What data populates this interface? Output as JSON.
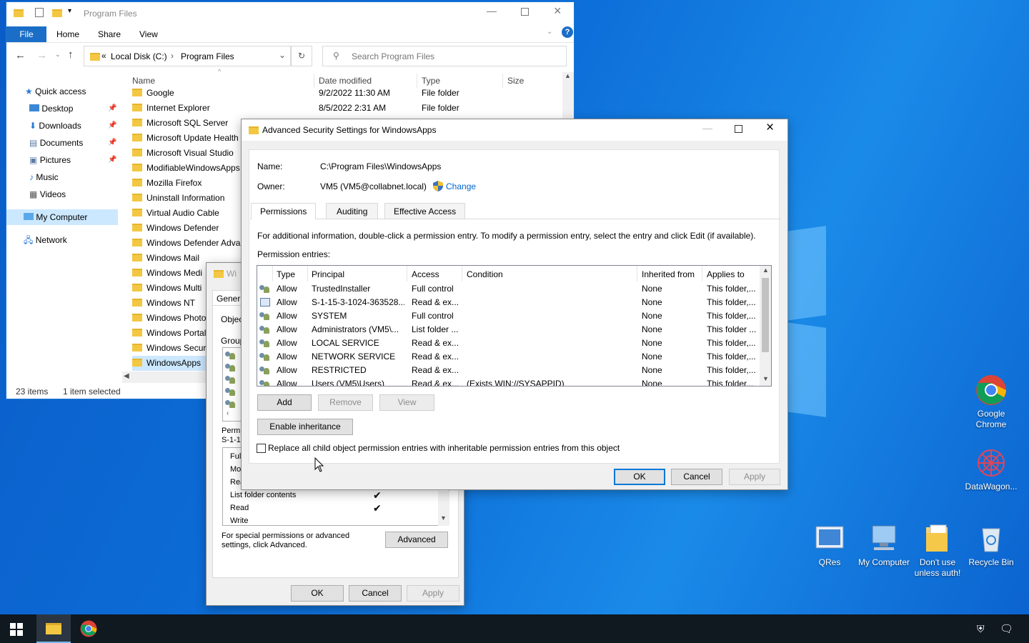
{
  "desktop": {
    "icons": [
      {
        "label": "Google Chrome"
      },
      {
        "label": "DataWagon..."
      },
      {
        "label": "QRes"
      },
      {
        "label": "My Computer"
      },
      {
        "label": "Don't use unless auth!"
      },
      {
        "label": "Recycle Bin"
      }
    ]
  },
  "explorer": {
    "title": "Program Files",
    "tabs": [
      "File",
      "Home",
      "Share",
      "View"
    ],
    "address": {
      "prefix": "«",
      "crumb1": "Local Disk (C:)",
      "sep": "›",
      "crumb2": "Program Files"
    },
    "search_placeholder": "Search Program Files",
    "nav": {
      "quick_access": "Quick access",
      "items": [
        "Desktop",
        "Downloads",
        "Documents",
        "Pictures",
        "Music",
        "Videos"
      ],
      "my_computer": "My Computer",
      "network": "Network"
    },
    "columns": {
      "name": "Name",
      "date": "Date modified",
      "type": "Type",
      "size": "Size"
    },
    "rows": [
      {
        "name": "Google",
        "date": "9/2/2022 11:30 AM",
        "type": "File folder"
      },
      {
        "name": "Internet Explorer",
        "date": "8/5/2022 2:31 AM",
        "type": "File folder"
      },
      {
        "name": "Microsoft SQL Server"
      },
      {
        "name": "Microsoft Update Health"
      },
      {
        "name": "Microsoft Visual Studio"
      },
      {
        "name": "ModifiableWindowsApps"
      },
      {
        "name": "Mozilla Firefox"
      },
      {
        "name": "Uninstall Information"
      },
      {
        "name": "Virtual Audio Cable"
      },
      {
        "name": "Windows Defender"
      },
      {
        "name": "Windows Defender Adva"
      },
      {
        "name": "Windows Mail"
      },
      {
        "name": "Windows Medi"
      },
      {
        "name": "Windows Multi"
      },
      {
        "name": "Windows NT"
      },
      {
        "name": "Windows Photo"
      },
      {
        "name": "Windows Portal"
      },
      {
        "name": "Windows Secur"
      },
      {
        "name": "WindowsApps"
      }
    ],
    "status": {
      "count": "23 items",
      "selected": "1 item selected"
    }
  },
  "props": {
    "title": "Wi",
    "tab_general": "Genera",
    "object_label": "Objec",
    "group_label": "Group",
    "perm_label": "Permi",
    "perm_sid": "S-1-15",
    "perm_rows": [
      {
        "name": "Full",
        "check": ""
      },
      {
        "name": "Mo",
        "check": ""
      },
      {
        "name": "Rea",
        "check": ""
      },
      {
        "name": "List folder contents",
        "check": "✔"
      },
      {
        "name": "Read",
        "check": "✔"
      },
      {
        "name": "Write",
        "check": ""
      }
    ],
    "special_text": "For special permissions or advanced settings, click Advanced.",
    "advanced_btn": "Advanced",
    "ok": "OK",
    "cancel": "Cancel",
    "apply": "Apply"
  },
  "adv": {
    "title": "Advanced Security Settings for WindowsApps",
    "name_label": "Name:",
    "name_value": "C:\\Program Files\\WindowsApps",
    "owner_label": "Owner:",
    "owner_value": "VM5 (VM5@collabnet.local)",
    "change_link": "Change",
    "tabs": [
      "Permissions",
      "Auditing",
      "Effective Access"
    ],
    "info_text": "For additional information, double-click a permission entry. To modify a permission entry, select the entry and click Edit (if available).",
    "entries_label": "Permission entries:",
    "columns": {
      "type": "Type",
      "principal": "Principal",
      "access": "Access",
      "condition": "Condition",
      "inherited": "Inherited from",
      "applies": "Applies to"
    },
    "entries": [
      {
        "type": "Allow",
        "principal": "TrustedInstaller",
        "access": "Full control",
        "condition": "",
        "inherited": "None",
        "applies": "This folder,..."
      },
      {
        "type": "Allow",
        "principal": "S-1-15-3-1024-363528...",
        "access": "Read & ex...",
        "condition": "",
        "inherited": "None",
        "applies": "This folder,..."
      },
      {
        "type": "Allow",
        "principal": "SYSTEM",
        "access": "Full control",
        "condition": "",
        "inherited": "None",
        "applies": "This folder,..."
      },
      {
        "type": "Allow",
        "principal": "Administrators (VM5\\...",
        "access": "List folder ...",
        "condition": "",
        "inherited": "None",
        "applies": "This folder ..."
      },
      {
        "type": "Allow",
        "principal": "LOCAL SERVICE",
        "access": "Read & ex...",
        "condition": "",
        "inherited": "None",
        "applies": "This folder,..."
      },
      {
        "type": "Allow",
        "principal": "NETWORK SERVICE",
        "access": "Read & ex...",
        "condition": "",
        "inherited": "None",
        "applies": "This folder,..."
      },
      {
        "type": "Allow",
        "principal": "RESTRICTED",
        "access": "Read & ex...",
        "condition": "",
        "inherited": "None",
        "applies": "This folder,..."
      },
      {
        "type": "Allow",
        "principal": "Users (VM5\\Users)",
        "access": "Read & ex...",
        "condition": "(Exists WIN://SYSAPPID)",
        "inherited": "None",
        "applies": "This folder..."
      }
    ],
    "add": "Add",
    "remove": "Remove",
    "view": "View",
    "enable_inheritance": "Enable inheritance",
    "replace_label": "Replace all child object permission entries with inheritable permission entries from this object",
    "ok": "OK",
    "cancel": "Cancel",
    "apply": "Apply"
  }
}
